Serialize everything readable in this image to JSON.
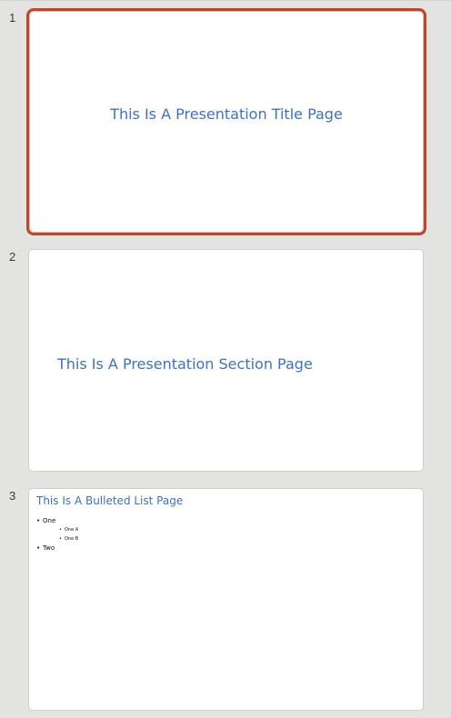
{
  "slides": [
    {
      "number": "1",
      "title": "This Is A Presentation Title Page",
      "selected": true
    },
    {
      "number": "2",
      "title": "This Is A Presentation Section Page",
      "selected": false
    },
    {
      "number": "3",
      "title": "This Is A Bulleted List Page",
      "selected": false,
      "bullets": {
        "item1": "One",
        "item1_sub1": "One A",
        "item1_sub2": "One B",
        "item2": "Two",
        "bullet_char": "•"
      }
    }
  ],
  "colors": {
    "accent_selected_border": "#c0452c",
    "title_text": "#3e72c0",
    "panel_background": "#e3e3e2"
  }
}
